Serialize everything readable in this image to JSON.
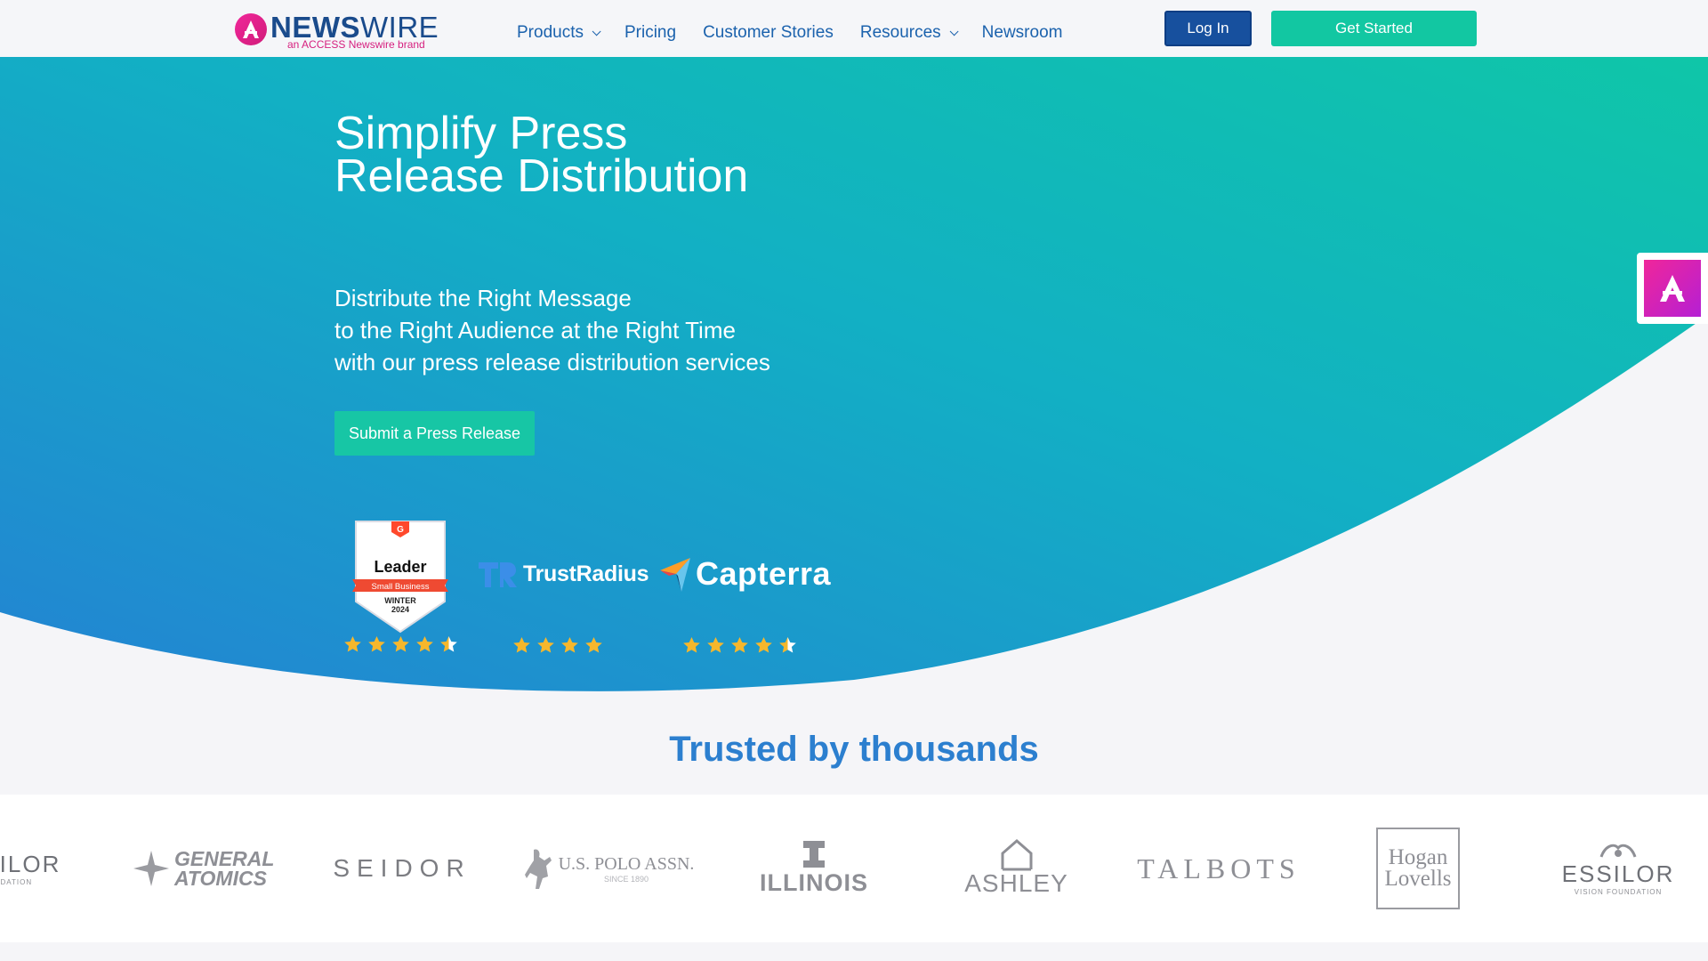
{
  "header": {
    "logo": {
      "word_bold": "NEWS",
      "word_light": "WIRE",
      "tagline": "an ACCESS Newswire brand"
    },
    "nav": [
      {
        "label": "Products",
        "dropdown": true
      },
      {
        "label": "Pricing",
        "dropdown": false
      },
      {
        "label": "Customer Stories",
        "dropdown": false
      },
      {
        "label": "Resources",
        "dropdown": true
      },
      {
        "label": "Newsroom",
        "dropdown": false
      }
    ],
    "login_label": "Log In",
    "get_started_label": "Get Started"
  },
  "hero": {
    "title": "Simplify Press Release Distribution",
    "subtitle_lines": [
      "Distribute the Right Message",
      "to the Right Audience at the Right Time",
      "with our press release distribution services"
    ],
    "cta_label": "Submit a Press Release",
    "gradient": {
      "from": "#2383d3",
      "to": "#0fc6a8"
    }
  },
  "ratings": {
    "g2": {
      "title": "Leader",
      "ribbon": "Small Business",
      "season": "WINTER",
      "year": "2024",
      "stars": 4.5
    },
    "trustradius": {
      "name": "TrustRadius",
      "stars": 4
    },
    "capterra": {
      "name": "Capterra",
      "stars": 4.5
    }
  },
  "trusted": {
    "heading": "Trusted by thousands",
    "brands": [
      {
        "name": "ESSILOR",
        "sub": "FOUNDATION"
      },
      {
        "name": "GENERAL ATOMICS"
      },
      {
        "name": "SEIDOR"
      },
      {
        "name": "U.S. POLO ASSN.",
        "sub": "SINCE 1890"
      },
      {
        "name": "ILLINOIS"
      },
      {
        "name": "ASHLEY"
      },
      {
        "name": "TALBOTS"
      },
      {
        "name": "Hogan Lovells"
      },
      {
        "name": "ESSILOR",
        "sub": "VISION FOUNDATION"
      }
    ]
  },
  "colors": {
    "brand_blue": "#1b62ad",
    "brand_pink": "#e0218a",
    "accent_teal": "#12c7a2",
    "star": "#f6b72c"
  }
}
